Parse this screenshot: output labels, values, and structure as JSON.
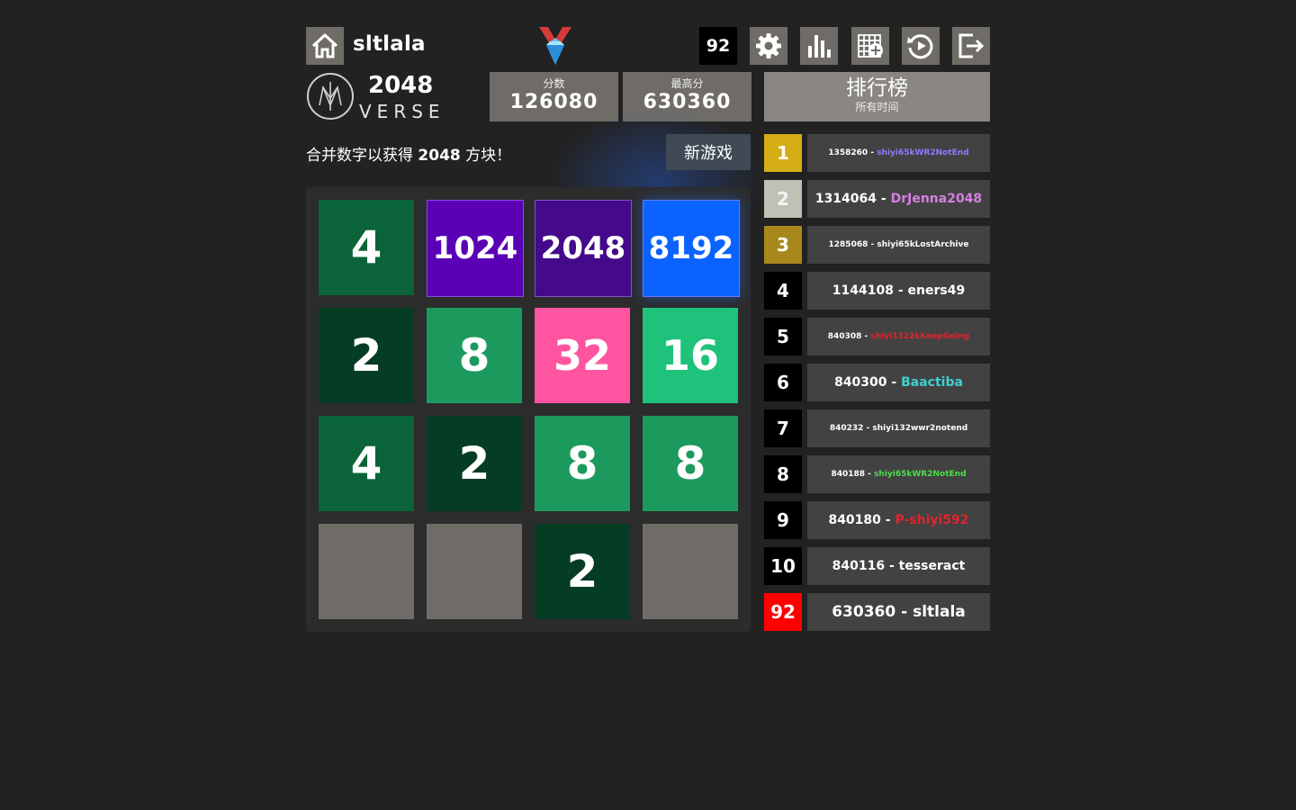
{
  "header": {
    "username": "sltlala",
    "rank_badge": "92",
    "icons": [
      "home-icon",
      "medal-icon",
      "settings-icon",
      "stats-icon",
      "add-board-icon",
      "replay-icon",
      "logout-icon"
    ]
  },
  "logo": {
    "title": "2048",
    "subtitle": "VERSE"
  },
  "scores": {
    "score_label": "分数",
    "score_value": "126080",
    "best_label": "最高分",
    "best_value": "630360"
  },
  "leaderboard_header": {
    "title": "排行榜",
    "period": "所有时间"
  },
  "instruction": {
    "before": "合并数字以获得 ",
    "bold": "2048",
    "after": " 方块！"
  },
  "new_game_label": "新游戏",
  "board": {
    "size": 4,
    "tiles": [
      [
        "4",
        "1024",
        "2048",
        "8192"
      ],
      [
        "2",
        "8",
        "32",
        "16"
      ],
      [
        "4",
        "2",
        "8",
        "8"
      ],
      [
        "",
        "",
        "2",
        ""
      ]
    ],
    "tile_colors": {
      "": "#6f6c67",
      "2": "#053d24",
      "4": "#0b6339",
      "8": "#1c9a5d",
      "16": "#1fc27a",
      "32": "#ff55a0",
      "1024": "#5a00b5",
      "2048": "#440a8a",
      "8192": "#0a63ff"
    }
  },
  "leaderboard": [
    {
      "rank": "1",
      "score": "1358260",
      "name": "shiyi65kWR2NotEnd",
      "rank_bg": "#d4ae14",
      "name_color": "#8a7cff",
      "small": true
    },
    {
      "rank": "2",
      "score": "1314064",
      "name": "DrJenna2048",
      "rank_bg": "#c0c0b4",
      "name_color": "#d77fe3",
      "small": false
    },
    {
      "rank": "3",
      "score": "1285068",
      "name": "shiyi65kLostArchive",
      "rank_bg": "#a8881c",
      "name_color": "#ffffff",
      "small": true
    },
    {
      "rank": "4",
      "score": "1144108",
      "name": "eners49",
      "rank_bg": "#000000",
      "name_color": "#ffffff",
      "small": false
    },
    {
      "rank": "5",
      "score": "840308",
      "name": "shiyi1322kKeepGoing",
      "rank_bg": "#000000",
      "name_color": "#e0242e",
      "small": true
    },
    {
      "rank": "6",
      "score": "840300",
      "name": "Baactiba",
      "rank_bg": "#000000",
      "name_color": "#3fd0d0",
      "small": false
    },
    {
      "rank": "7",
      "score": "840232",
      "name": "shiyi132wwr2notend",
      "rank_bg": "#000000",
      "name_color": "#ffffff",
      "small": true
    },
    {
      "rank": "8",
      "score": "840188",
      "name": "shiyi65kWR2NotEnd",
      "rank_bg": "#000000",
      "name_color": "#4bde4b",
      "small": true
    },
    {
      "rank": "9",
      "score": "840180",
      "name": "P-shiyi592",
      "rank_bg": "#000000",
      "name_color": "#e0242e",
      "small": false
    },
    {
      "rank": "10",
      "score": "840116",
      "name": "tesseract",
      "rank_bg": "#000000",
      "name_color": "#ffffff",
      "small": false
    },
    {
      "rank": "92",
      "score": "630360",
      "name": "sltlala",
      "rank_bg": "#ff0000",
      "name_color": "#ffffff",
      "small": false
    }
  ]
}
